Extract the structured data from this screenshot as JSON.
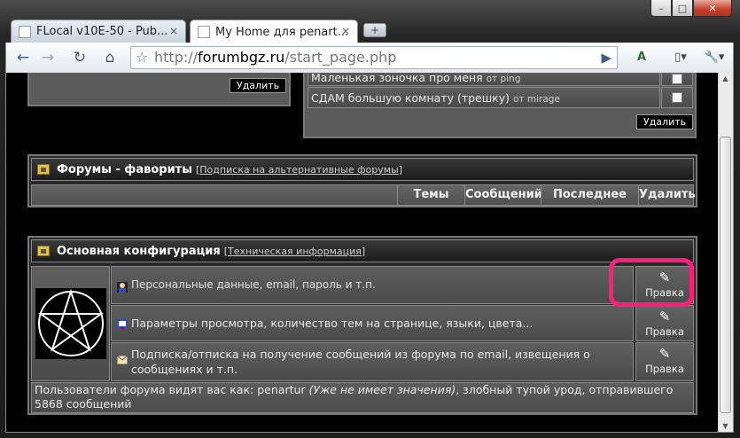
{
  "window": {
    "controls": {
      "minimize": "–",
      "maximize": "□",
      "close": "✕"
    }
  },
  "tabs": [
    {
      "title": "FLocal v10E-50 - Pub...",
      "close": "×"
    },
    {
      "title": "My Home для penart...",
      "close": "×"
    }
  ],
  "new_tab": "+",
  "toolbar": {
    "back": "←",
    "forward": "→",
    "reload": "↻",
    "home": "⌂",
    "star": "☆",
    "go": "▶",
    "url_scheme": "http://",
    "url_host": "forumbgz.ru",
    "url_path": "/start_page.php",
    "translate": "A",
    "page_menu": "▯▾",
    "tools_menu": "🔧▾"
  },
  "top_panel": {
    "delete_label": "Удалить"
  },
  "subscriptions": {
    "items": [
      {
        "title": "Маленькая зоночка про меня",
        "from": "от ping"
      },
      {
        "title": "СДАМ большую комнату (трешку)",
        "from": "от mirage"
      }
    ],
    "delete_label": "Удалить"
  },
  "favorites": {
    "title": "Форумы - фавориты",
    "link": "Подписка на альтернативные форумы",
    "columns": [
      "Темы",
      "Сообщений",
      "Последнее",
      "Удалить"
    ]
  },
  "config": {
    "title": "Основная конфигурация",
    "link": "Техническая информация",
    "rows": [
      {
        "text": "Персональные данные, email, пароль и т.п.",
        "edit": "Правка",
        "pen": "✎"
      },
      {
        "text": "Параметры просмотра, количество тем на странице, языки, цвета...",
        "edit": "Правка",
        "pen": "✎"
      },
      {
        "text": "Подписка/отписка на получение сообщений из форума по email, извещения о сообщениях и т.п.",
        "edit": "Правка",
        "pen": "✎"
      }
    ],
    "footer_prefix": "Пользователи форума видят вас как: penartur ",
    "footer_italic": "(Уже не имеет значения)",
    "footer_suffix": ", злобный тупой урод, отправившего 5868 сообщений"
  },
  "colors": {
    "highlight": "#ff1f7a",
    "page_bg": "#000000"
  }
}
